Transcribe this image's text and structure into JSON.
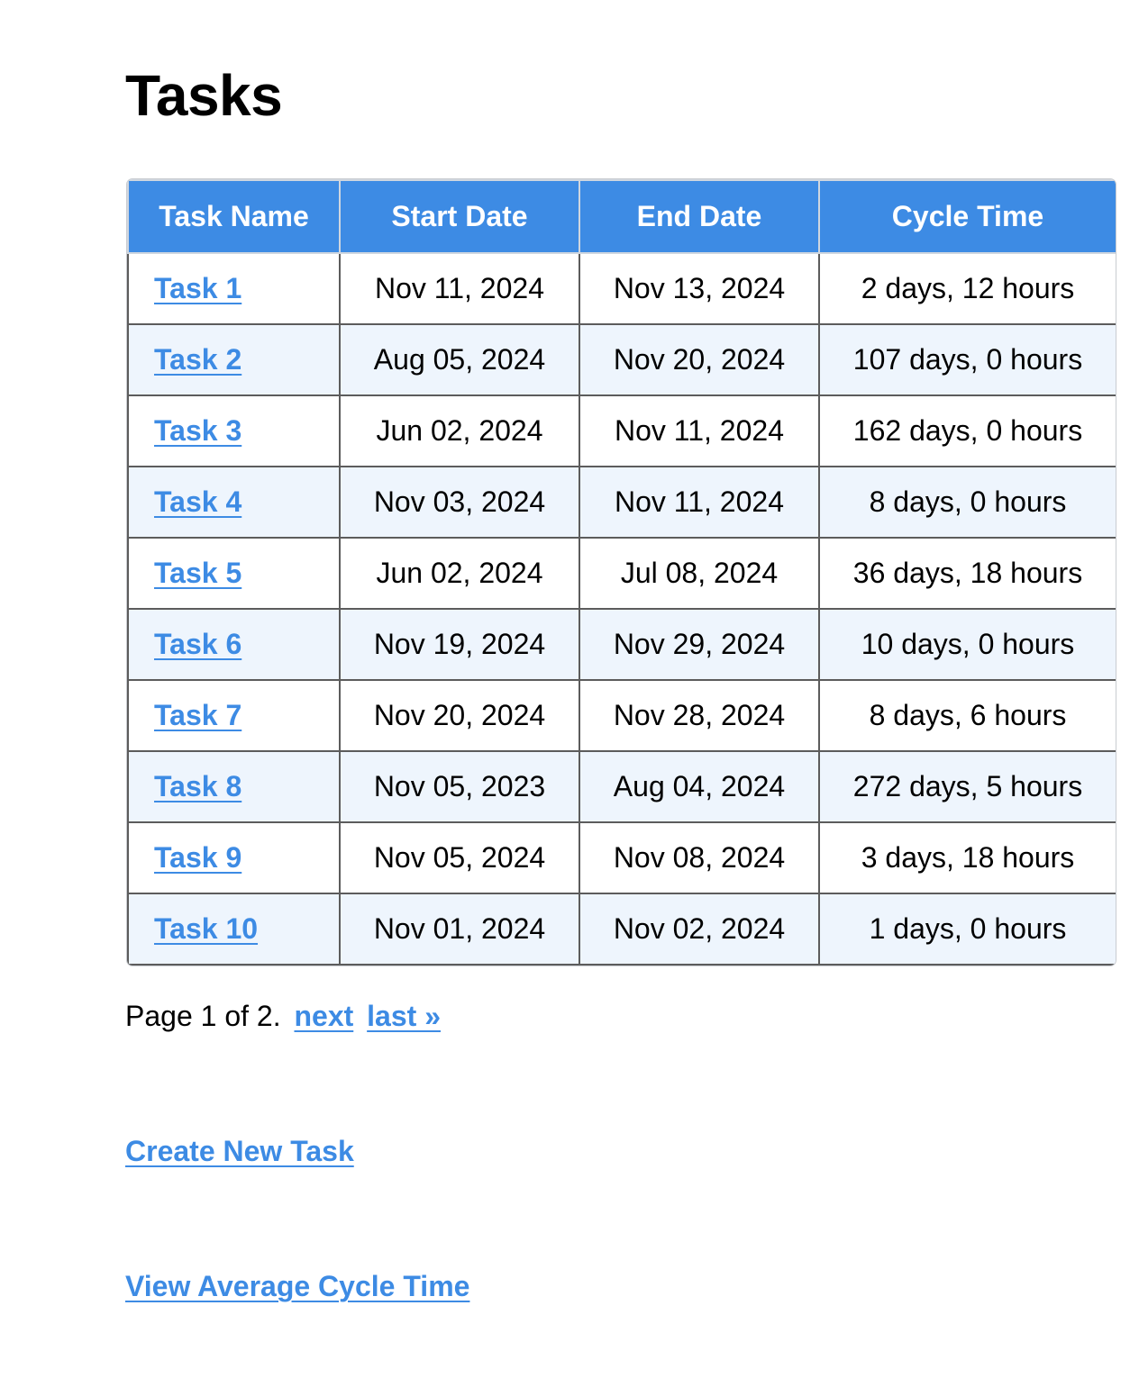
{
  "page": {
    "title": "Tasks"
  },
  "table": {
    "headers": [
      "Task Name",
      "Start Date",
      "End Date",
      "Cycle Time"
    ],
    "rows": [
      {
        "name": "Task 1",
        "start": "Nov 11, 2024",
        "end": "Nov 13, 2024",
        "cycle": "2 days, 12 hours"
      },
      {
        "name": "Task 2",
        "start": "Aug 05, 2024",
        "end": "Nov 20, 2024",
        "cycle": "107 days, 0 hours"
      },
      {
        "name": "Task 3",
        "start": "Jun 02, 2024",
        "end": "Nov 11, 2024",
        "cycle": "162 days, 0 hours"
      },
      {
        "name": "Task 4",
        "start": "Nov 03, 2024",
        "end": "Nov 11, 2024",
        "cycle": "8 days, 0 hours"
      },
      {
        "name": "Task 5",
        "start": "Jun 02, 2024",
        "end": "Jul 08, 2024",
        "cycle": "36 days, 18 hours"
      },
      {
        "name": "Task 6",
        "start": "Nov 19, 2024",
        "end": "Nov 29, 2024",
        "cycle": "10 days, 0 hours"
      },
      {
        "name": "Task 7",
        "start": "Nov 20, 2024",
        "end": "Nov 28, 2024",
        "cycle": "8 days, 6 hours"
      },
      {
        "name": "Task 8",
        "start": "Nov 05, 2023",
        "end": "Aug 04, 2024",
        "cycle": "272 days, 5 hours"
      },
      {
        "name": "Task 9",
        "start": "Nov 05, 2024",
        "end": "Nov 08, 2024",
        "cycle": "3 days, 18 hours"
      },
      {
        "name": "Task 10",
        "start": "Nov 01, 2024",
        "end": "Nov 02, 2024",
        "cycle": "1 days, 0 hours"
      }
    ]
  },
  "pagination": {
    "status": "Page 1 of 2.",
    "next_label": "next",
    "last_label": "last »"
  },
  "actions": {
    "create_label": "Create New Task",
    "average_label": "View Average Cycle Time"
  },
  "colors": {
    "accent": "#3d8be4",
    "row_alt": "#eef5fd"
  }
}
